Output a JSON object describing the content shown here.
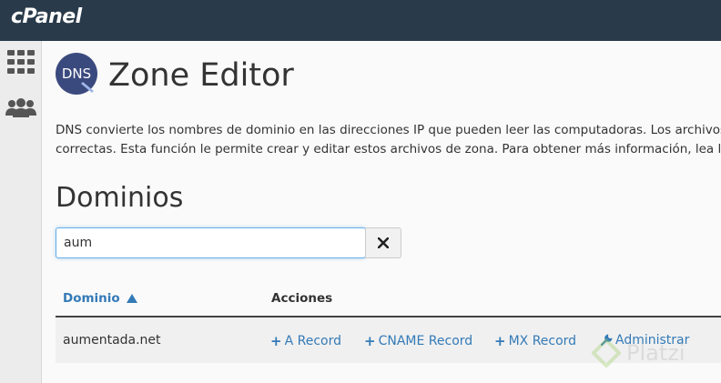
{
  "header": {
    "brand": "cPanel"
  },
  "sidebar": {
    "items": [
      {
        "icon": "grid-icon"
      },
      {
        "icon": "users-icon"
      }
    ]
  },
  "page": {
    "icon_text": "DNS",
    "title": "Zone Editor",
    "description_line1": "DNS convierte los nombres de dominio en las direcciones IP que pueden leer las computadoras. Los archivos de",
    "description_line2": "correctas. Esta función le permite crear y editar estos archivos de zona. Para obtener más información, lea lo sig"
  },
  "domains": {
    "title": "Dominios",
    "search": {
      "value": "aum",
      "placeholder": ""
    },
    "table": {
      "headers": {
        "domain": "Dominio",
        "actions": "Acciones"
      },
      "rows": [
        {
          "domain": "aumentada.net",
          "actions": {
            "a_record": "A Record",
            "cname_record": "CNAME Record",
            "mx_record": "MX Record",
            "administrar": "Administrar"
          }
        }
      ]
    }
  },
  "watermark": {
    "text": "Platzi"
  }
}
